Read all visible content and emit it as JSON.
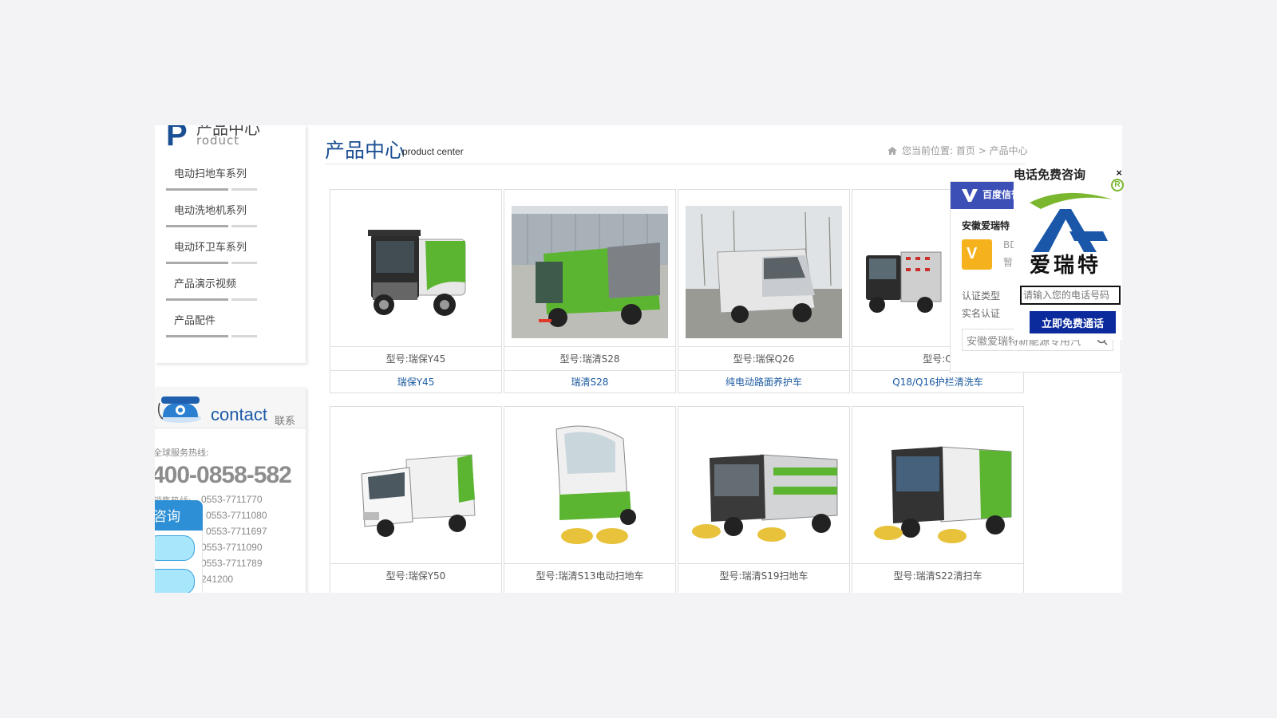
{
  "sidebar": {
    "head_zh": "产品中心",
    "head_en": "roduct",
    "head_letter": "P",
    "items": [
      {
        "label": "电动扫地车系列"
      },
      {
        "label": "电动洗地机系列"
      },
      {
        "label": "电动环卫车系列"
      },
      {
        "label": "产品演示视频"
      },
      {
        "label": "产品配件"
      }
    ]
  },
  "contact": {
    "title": "contact",
    "title_zh": "联系",
    "hotline_label": "全球服务热线:",
    "hotline": "400-0858-582",
    "sales_label": "销售热线:",
    "numbers": [
      "0553-7711770",
      "0553-7711080",
      "0553-7711697",
      "0553-7711090",
      "0553-7711789",
      "241200"
    ],
    "consult_tab": "咨询"
  },
  "main": {
    "title": "产品中心",
    "subtitle": "product center",
    "breadcrumb_prefix": "您当前位置:",
    "breadcrumb_home": "首页",
    "breadcrumb_sep": ">",
    "breadcrumb_current": "产品中心"
  },
  "products": [
    {
      "model": "型号:瑞保Y45",
      "name": "瑞保Y45"
    },
    {
      "model": "型号:瑞清S28",
      "name": "瑞清S28"
    },
    {
      "model": "型号:瑞保Q26",
      "name": "纯电动路面养护车"
    },
    {
      "model": "型号:Q",
      "name": "Q18/Q16护栏清洗车"
    },
    {
      "model": "型号:瑞保Y50",
      "name": ""
    },
    {
      "model": "型号:瑞清S13电动扫地车",
      "name": ""
    },
    {
      "model": "型号:瑞清S19扫地车",
      "name": ""
    },
    {
      "model": "型号:瑞清S22清扫车",
      "name": ""
    }
  ],
  "baidu": {
    "logo": "百度信誉",
    "company": "安徽爱瑞特",
    "v3": "V",
    "small1": "BD",
    "small2": "暂:",
    "row1": "认证类型",
    "row2": "实名认证",
    "search_value": "安徽爱瑞特新能源专用汽"
  },
  "call": {
    "title": "电话免费咨询",
    "close": "×",
    "brand": "爱瑞特",
    "r_mark": "R",
    "input_placeholder": "请输入您的电话号码",
    "button": "立即免费通话"
  },
  "colors": {
    "brand_blue": "#1b4f93",
    "link_blue": "#1b5aa0",
    "vehicle_green": "#5cb531",
    "call_button": "#0b2a9c"
  }
}
